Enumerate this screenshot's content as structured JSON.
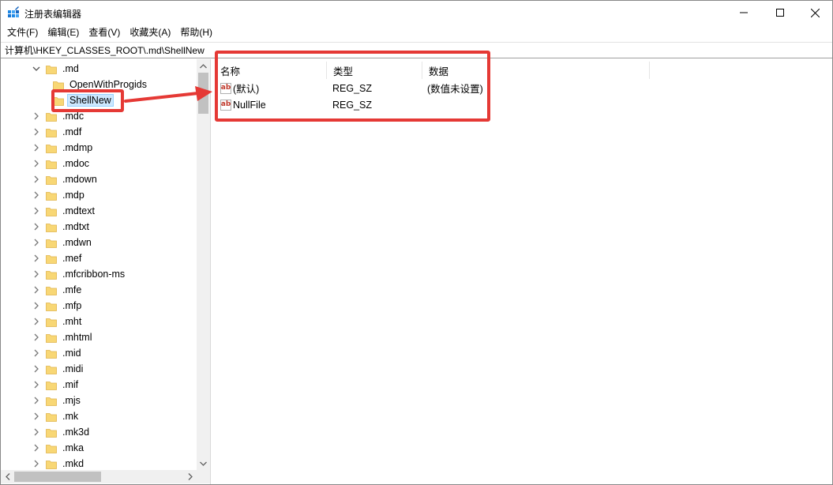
{
  "window": {
    "title": "注册表编辑器",
    "controls": {
      "minimize": "minimize",
      "maximize": "maximize",
      "close": "close"
    }
  },
  "menu": [
    "文件(F)",
    "编辑(E)",
    "查看(V)",
    "收藏夹(A)",
    "帮助(H)"
  ],
  "address": "计算机\\HKEY_CLASSES_ROOT\\.md\\ShellNew",
  "tree": {
    "items": [
      {
        "label": ".md",
        "expanded": true
      },
      {
        "label": "OpenWithProgids",
        "child": true
      },
      {
        "label": "ShellNew",
        "child": true,
        "selected": true
      },
      {
        "label": ".mdc"
      },
      {
        "label": ".mdf"
      },
      {
        "label": ".mdmp"
      },
      {
        "label": ".mdoc"
      },
      {
        "label": ".mdown"
      },
      {
        "label": ".mdp"
      },
      {
        "label": ".mdtext"
      },
      {
        "label": ".mdtxt"
      },
      {
        "label": ".mdwn"
      },
      {
        "label": ".mef"
      },
      {
        "label": ".mfcribbon-ms"
      },
      {
        "label": ".mfe"
      },
      {
        "label": ".mfp"
      },
      {
        "label": ".mht"
      },
      {
        "label": ".mhtml"
      },
      {
        "label": ".mid"
      },
      {
        "label": ".midi"
      },
      {
        "label": ".mif"
      },
      {
        "label": ".mjs"
      },
      {
        "label": ".mk"
      },
      {
        "label": ".mk3d"
      },
      {
        "label": ".mka"
      },
      {
        "label": ".mkd"
      }
    ]
  },
  "values": {
    "columns": [
      "名称",
      "类型",
      "数据"
    ],
    "rows": [
      {
        "name": "(默认)",
        "type": "REG_SZ",
        "data": "(数值未设置)"
      },
      {
        "name": "NullFile",
        "type": "REG_SZ",
        "data": ""
      }
    ]
  },
  "colors": {
    "annotation": "#e53935",
    "folder": "#f8d775",
    "selection": "#cce8ff"
  }
}
